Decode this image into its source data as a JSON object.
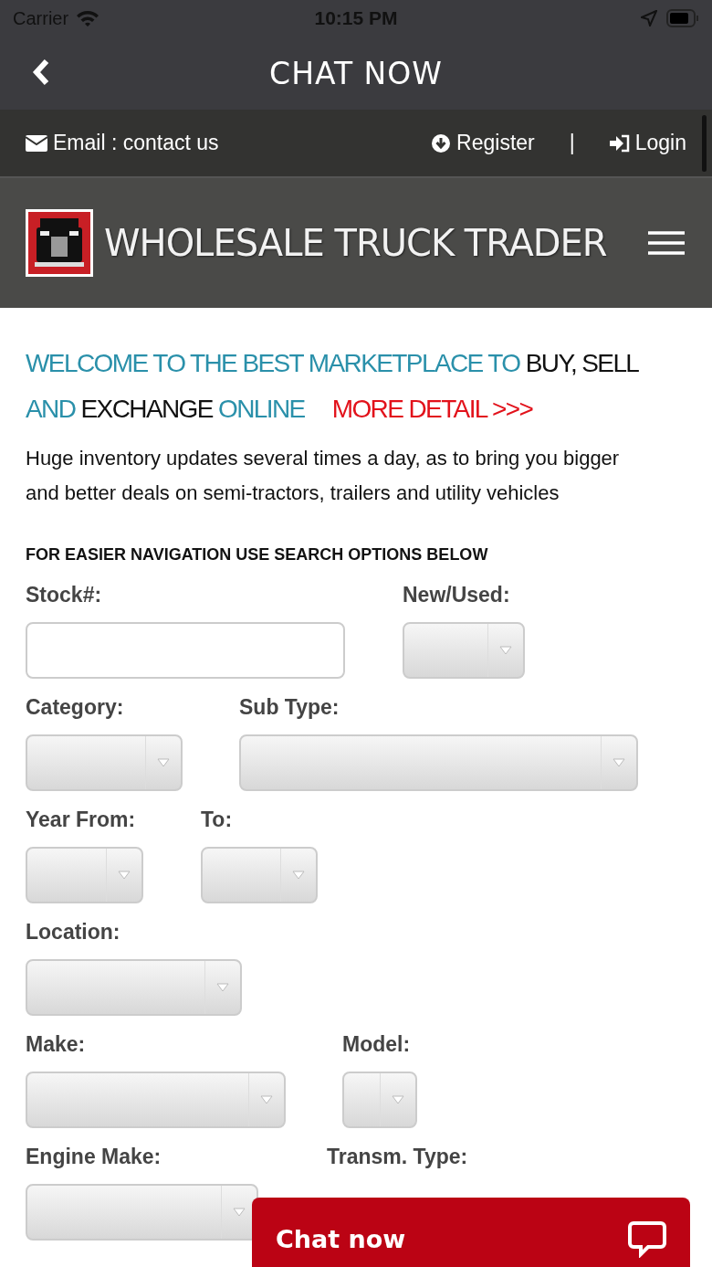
{
  "status_bar": {
    "carrier": "Carrier",
    "time": "10:15 PM"
  },
  "nav_bar": {
    "title": "CHAT NOW"
  },
  "top_bar": {
    "email": "Email : contact us",
    "register": "Register",
    "separator": "|",
    "login": "Login"
  },
  "header": {
    "title": "WHOLESALE TRUCK TRADER"
  },
  "headline": [
    {
      "kind": "accent",
      "text": "WELCOME TO THE BEST MARKETPLACE TO "
    },
    {
      "kind": "plain",
      "text": "BUY, SELL"
    },
    {
      "kind": "accent",
      "text": " AND "
    },
    {
      "kind": "plain",
      "text": "EXCHANGE"
    },
    {
      "kind": "accent",
      "text": " ONLINE"
    },
    {
      "kind": "link",
      "text": "MORE DETAIL >>>"
    }
  ],
  "intro": "Huge inventory updates several times a day, as to bring you bigger and better deals on semi-tractors, trailers and utility vehicles",
  "search_heading": "FOR EASIER NAVIGATION USE SEARCH OPTIONS BELOW",
  "form_rows": [
    [
      {
        "label": "Stock#:",
        "kind": "text"
      },
      {
        "label": "New/Used:",
        "kind": "select"
      }
    ],
    [
      {
        "label": "Category:",
        "kind": "select"
      },
      {
        "label": "Sub Type:",
        "kind": "select"
      }
    ],
    [
      {
        "label": "Year From:",
        "kind": "select"
      },
      {
        "label": "To:",
        "kind": "select"
      }
    ],
    [
      {
        "label": "Location:",
        "kind": "select"
      }
    ],
    [
      {
        "label": "Make:",
        "kind": "select"
      },
      {
        "label": "Model:",
        "kind": "select"
      }
    ],
    [
      {
        "label": "Engine Make:",
        "kind": "select"
      },
      {
        "label": "Transm. Type:"
      }
    ]
  ],
  "chat_button": {
    "label": "Chat now"
  }
}
